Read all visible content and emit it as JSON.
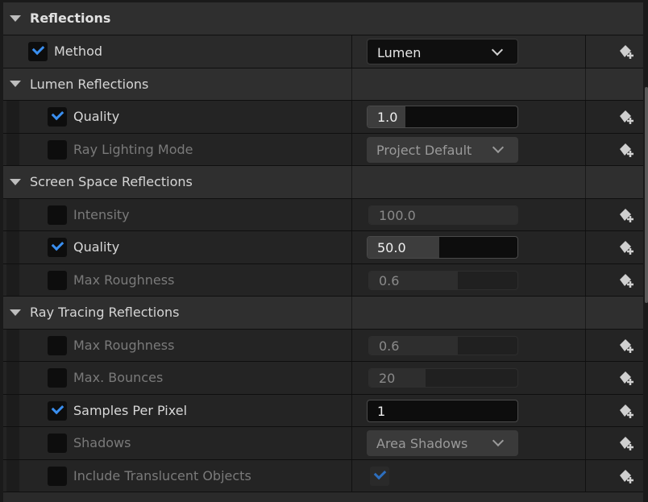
{
  "sections": {
    "reflections": {
      "title": "Reflections",
      "method": {
        "label": "Method",
        "checked": true,
        "value": "Lumen"
      }
    },
    "lumen": {
      "title": "Lumen Reflections",
      "quality": {
        "label": "Quality",
        "checked": true,
        "value": "1.0",
        "fill": 0.25
      },
      "ray_lighting_mode": {
        "label": "Ray Lighting Mode",
        "checked": false,
        "value": "Project Default"
      }
    },
    "ssr": {
      "title": "Screen Space Reflections",
      "intensity": {
        "label": "Intensity",
        "checked": false,
        "value": "100.0",
        "fill": 1.0
      },
      "quality": {
        "label": "Quality",
        "checked": true,
        "value": "50.0",
        "fill": 0.48
      },
      "max_roughness": {
        "label": "Max Roughness",
        "checked": false,
        "value": "0.6",
        "fill": 0.6
      }
    },
    "rt": {
      "title": "Ray Tracing Reflections",
      "max_roughness": {
        "label": "Max Roughness",
        "checked": false,
        "value": "0.6",
        "fill": 0.6
      },
      "max_bounces": {
        "label": "Max. Bounces",
        "checked": false,
        "value": "20",
        "fill": 0.38
      },
      "samples_per_pixel": {
        "label": "Samples Per Pixel",
        "checked": true,
        "value": "1",
        "fill": 0
      },
      "shadows": {
        "label": "Shadows",
        "checked": false,
        "value": "Area Shadows"
      },
      "include_translucent": {
        "label": "Include Translucent Objects",
        "checked": false,
        "value_checked": true
      }
    }
  },
  "icons": {
    "reset": "reset-to-default-icon",
    "collapse": "collapse-arrow-icon",
    "check": "checkmark-icon"
  },
  "colors": {
    "accent": "#3a8ff0",
    "panel_bg": "#1a1a1a",
    "category_bg": "#2f2f2f"
  }
}
